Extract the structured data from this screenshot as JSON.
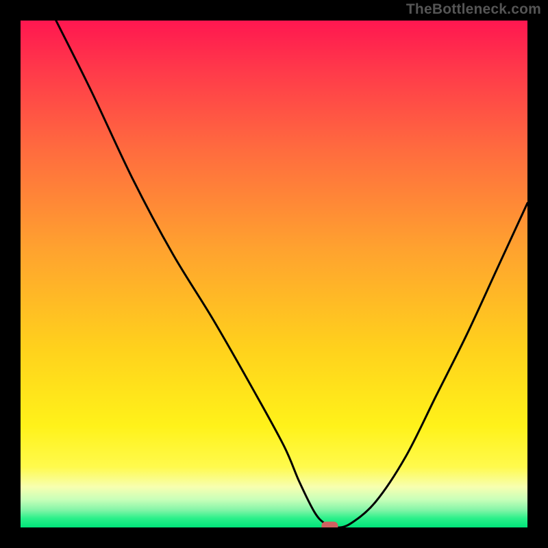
{
  "watermark": "TheBottleneck.com",
  "chart_data": {
    "type": "line",
    "title": "",
    "xlabel": "",
    "ylabel": "",
    "xlim": [
      0,
      100
    ],
    "ylim": [
      0,
      100
    ],
    "x": [
      7,
      14,
      22,
      30,
      38,
      46,
      52,
      55,
      58,
      60,
      62,
      65,
      70,
      76,
      82,
      88,
      94,
      100
    ],
    "values": [
      100,
      86,
      69,
      54,
      41,
      27,
      16,
      9,
      3,
      0.8,
      0,
      0.7,
      5,
      14,
      26,
      38,
      51,
      64
    ],
    "optimum_x": 61,
    "background_scale": {
      "top_color": "#ff1750",
      "mid_color": "#ffe400",
      "bottom_color": "#00e47a"
    },
    "marker": {
      "x": 61,
      "y": 0.2
    }
  }
}
